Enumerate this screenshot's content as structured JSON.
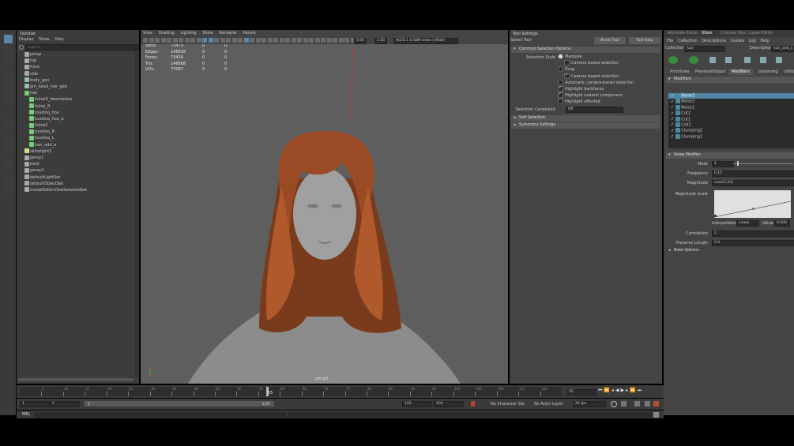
{
  "outliner": {
    "title": "Outliner",
    "menu": [
      "Display",
      "Show",
      "Help"
    ],
    "search_placeholder": "Search...",
    "items": [
      {
        "label": "persp",
        "kind": "camera"
      },
      {
        "label": "top",
        "kind": "camera"
      },
      {
        "label": "front",
        "kind": "camera"
      },
      {
        "label": "side",
        "kind": "camera"
      },
      {
        "label": "body_geo",
        "kind": "mesh"
      },
      {
        "label": "girl_head_hair_geo",
        "kind": "mesh"
      },
      {
        "label": "hair",
        "kind": "group"
      },
      {
        "label": "liuhaiX_description",
        "kind": "xgen"
      },
      {
        "label": "liuhai_R",
        "kind": "xgen"
      },
      {
        "label": "toudinq_hou",
        "kind": "xgen"
      },
      {
        "label": "toudinq_hou_b",
        "kind": "xgen"
      },
      {
        "label": "liuhaiC",
        "kind": "xgen"
      },
      {
        "label": "toudinq_R",
        "kind": "xgen"
      },
      {
        "label": "toudinq_L",
        "kind": "xgen"
      },
      {
        "label": "hair_add_a",
        "kind": "xgen"
      },
      {
        "label": "skinolight1",
        "kind": "light"
      },
      {
        "label": "persp1",
        "kind": "camera"
      },
      {
        "label": "back",
        "kind": "camera"
      },
      {
        "label": "persp2",
        "kind": "camera"
      },
      {
        "label": "defaultLightSet",
        "kind": "set"
      },
      {
        "label": "defaultObjectSet",
        "kind": "set"
      },
      {
        "label": "modelEditorViewSelectedSet",
        "kind": "set"
      }
    ]
  },
  "viewport": {
    "menu": [
      "View",
      "Shading",
      "Lighting",
      "Show",
      "Renderer",
      "Panels"
    ],
    "exposure": "0.00",
    "gamma": "1.00",
    "color_space": "ACES 1.0 SDR-video (sRGB)",
    "hud": [
      {
        "label": "Verts:",
        "v1": "73479",
        "v2": "0",
        "v3": "0"
      },
      {
        "label": "Edges:",
        "v1": "146916",
        "v2": "0",
        "v3": "0"
      },
      {
        "label": "Faces:",
        "v1": "73434",
        "v2": "0",
        "v3": "0"
      },
      {
        "label": "Tris:",
        "v1": "146868",
        "v2": "0",
        "v3": "0"
      },
      {
        "label": "UVs:",
        "v1": "77097",
        "v2": "0",
        "v3": "0"
      }
    ],
    "camera_label": "persp1"
  },
  "tool_settings": {
    "title": "Tool Settings",
    "tool_name": "Select Tool",
    "reset_label": "Reset Tool",
    "help_label": "Tool Help",
    "section": "Common Selection Options",
    "selection_style_label": "Selection Style",
    "options": [
      {
        "label": "Marquee",
        "type": "radio",
        "on": true
      },
      {
        "label": "Camera based selection",
        "type": "check",
        "on": false
      },
      {
        "label": "Drag",
        "type": "radio",
        "on": false
      },
      {
        "label": "Camera based selection",
        "type": "check",
        "on": true
      },
      {
        "label": "Automatic camera-based selection",
        "type": "check",
        "on": false
      },
      {
        "label": "Highlight backfaces",
        "type": "check",
        "on": true
      },
      {
        "label": "Highlight nearest component",
        "type": "check",
        "on": true
      },
      {
        "label": "Highlight affected",
        "type": "check",
        "on": false
      }
    ],
    "constraint_label": "Selection Constraint",
    "constraint_value": "Off",
    "frames": [
      "Soft Selection",
      "Symmetry Settings"
    ]
  },
  "xgen": {
    "tabs": [
      "Attribute Editor",
      "XGen",
      "Channel Box / Layer Editor"
    ],
    "active_tab": "XGen",
    "menu": [
      "File",
      "Collection",
      "Descriptions",
      "Guides",
      "Log",
      "Help"
    ],
    "collection_label": "Collection",
    "collection_value": "hair",
    "description_label": "Description",
    "description_value": "hair_add_a",
    "subtabs": [
      "Primitives",
      "Preview/Output",
      "Modifiers",
      "Grooming",
      "Utilities"
    ],
    "active_subtab": "Modifiers",
    "modifiers_title": "Modifiers",
    "modifiers": [
      "Noise3",
      "Noise2",
      "Noise1",
      "Cut2",
      "Cut1",
      "Coil1",
      "Clumping2",
      "Clumping1"
    ],
    "noise_title": "Noise Modifier",
    "mask_label": "Mask",
    "mask_value": "1",
    "frequency_label": "Frequency",
    "frequency_value": "0.15",
    "magnitude_label": "Magnitude",
    "magnitude_value": "rand(5,10)",
    "magnitude_scale_label": "Magnitude Scale",
    "interp_label": "Interpolation",
    "interp_value": "Linear",
    "value_label": "Value",
    "value_value": "0.000",
    "correlation_label": "Correlation",
    "correlation_value": "2",
    "preserve_label": "Preserve Length",
    "preserve_value": "0.0",
    "bake_label": "Bake Options"
  },
  "timeline": {
    "current_frame": "55",
    "frame_field": "55",
    "start": "1",
    "start2": "1",
    "range_start": "1",
    "range_end": "120",
    "end": "120",
    "end2": "200",
    "ticks": [
      "5",
      "10",
      "15",
      "20",
      "25",
      "30",
      "35",
      "40",
      "45",
      "50",
      "55",
      "60",
      "65",
      "70",
      "75",
      "80",
      "85",
      "90",
      "95",
      "100",
      "105",
      "110",
      "115",
      "120"
    ],
    "character_set": "No Character Set",
    "anim_layer": "No Anim Layer",
    "fps": "24 fps"
  },
  "command_line": {
    "label": "MEL"
  }
}
